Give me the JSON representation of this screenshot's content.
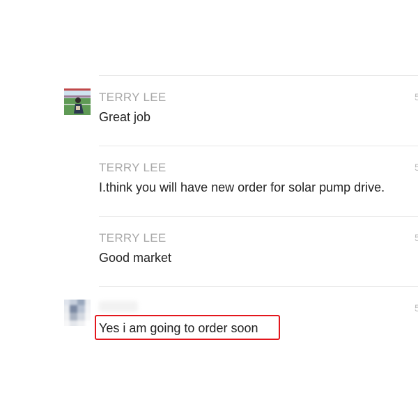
{
  "messages": [
    {
      "sender": "TERRY LEE",
      "text": "Great job",
      "time": "5"
    },
    {
      "sender": "TERRY LEE",
      "text": "I.think you will have new order for solar pump drive.",
      "time": "5"
    },
    {
      "sender": "TERRY LEE",
      "text": "Good market",
      "time": "5"
    },
    {
      "sender": "",
      "text": "Yes i am going to order soon",
      "time": "5"
    }
  ],
  "colors": {
    "sender": "#a8a8a8",
    "text": "#222222",
    "divider": "#e6e6e6",
    "highlight": "#e3161c"
  }
}
